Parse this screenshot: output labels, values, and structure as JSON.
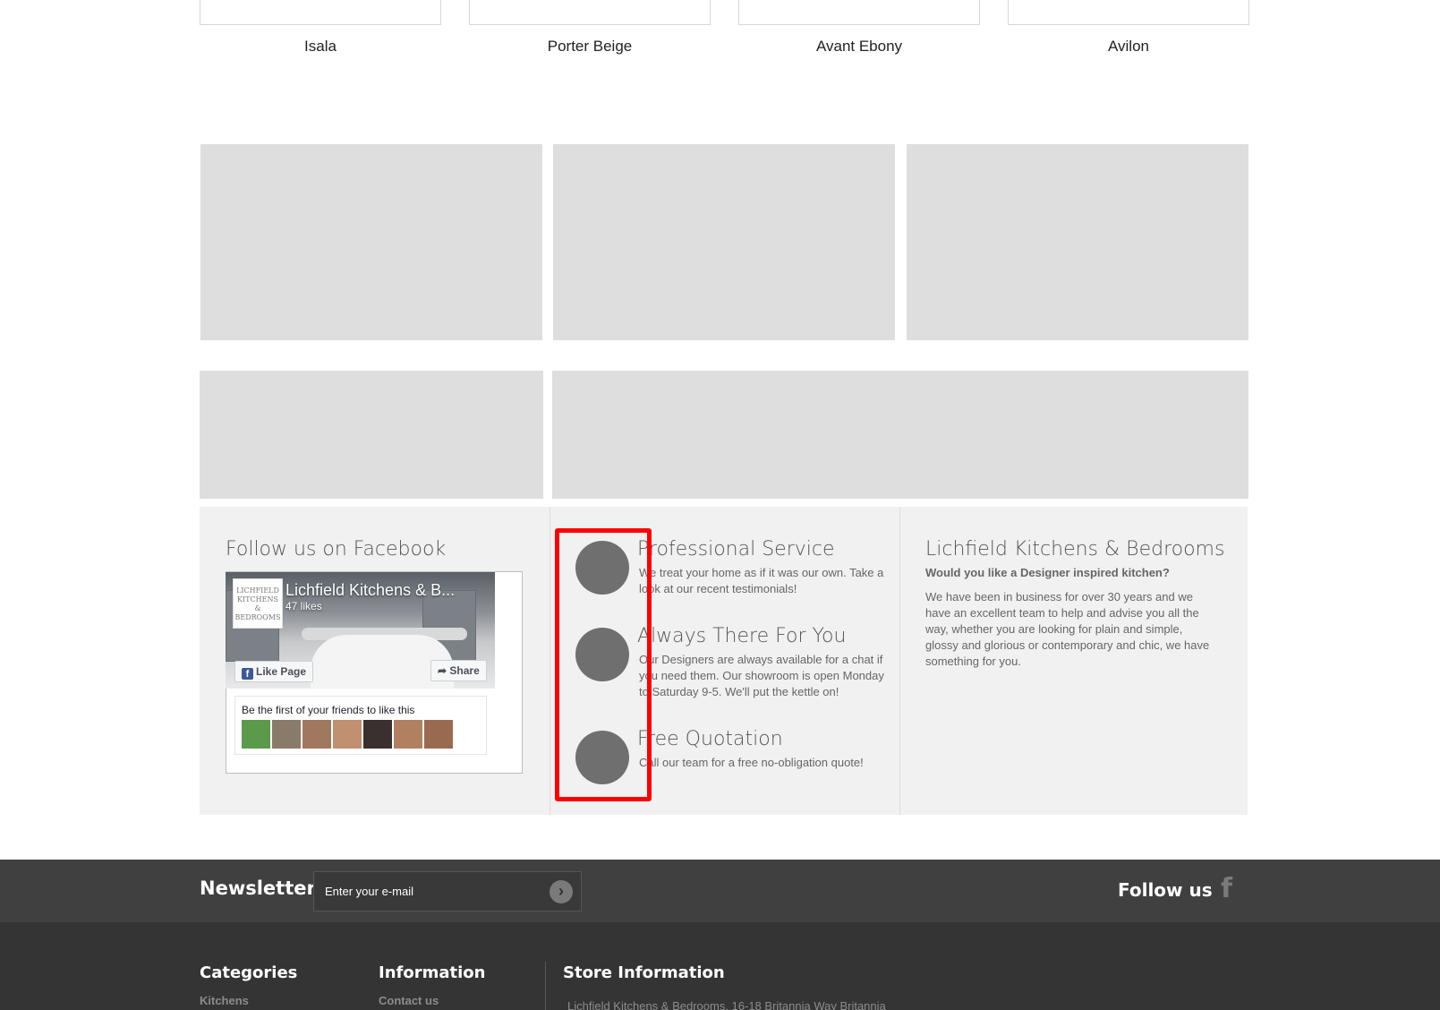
{
  "products": [
    {
      "name": "Isala"
    },
    {
      "name": "Porter Beige"
    },
    {
      "name": "Avant Ebony"
    },
    {
      "name": "Avilon"
    }
  ],
  "facebook_col": {
    "title": "Follow us on Facebook",
    "page_name": "Lichfield Kitchens & B...",
    "likes": "47 likes",
    "logo_text": "LICHFIELD KITCHENS & BEDROOMS",
    "like_button": "Like Page",
    "share_button": "Share",
    "friends_text": "Be the first of your friends to like this"
  },
  "features": [
    {
      "title": "Professional Service",
      "text": "We treat your home as if it was our own. Take a look at our recent testimonials!"
    },
    {
      "title": "Always There For You",
      "text": "Our Designers are always available for a chat if you need them. Our showroom is open Monday to Saturday 9-5. We'll put the kettle on!"
    },
    {
      "title": "Free Quotation",
      "text": "Call our team for a free no-obligation quote!"
    }
  ],
  "about": {
    "title": "Lichfield Kitchens & Bedrooms",
    "subtitle": "Would you like a Designer inspired kitchen?",
    "text": "We have been in business for over 30 years and we have an excellent team to help and advise you all the way, whether you are looking for plain and simple, glossy and glorious or contemporary and chic, we have something for you."
  },
  "newsletter": {
    "title": "Newsletter",
    "placeholder": "Enter your e-mail",
    "follow_label": "Follow us",
    "facebook_glyph": "f"
  },
  "footer": {
    "categories_title": "Categories",
    "categories_link": "Kitchens",
    "information_title": "Information",
    "information_link": "Contact us",
    "store_title": "Store Information",
    "store_text": "Lichfield Kitchens & Bedrooms, 16-18 Britannia Way Britannia"
  },
  "colors": {
    "placeholder_grey": "#dedede",
    "panel_bg": "#f1f1f1",
    "icon_circle": "#6f6f6f",
    "highlight": "#ff0000",
    "newsletter_bg": "#404040",
    "footer_bg": "#343434",
    "facebook_blue": "#3b5998"
  },
  "icons": {
    "go": "arrow-right-icon",
    "facebook": "facebook-icon",
    "share": "share-arrow-icon"
  }
}
